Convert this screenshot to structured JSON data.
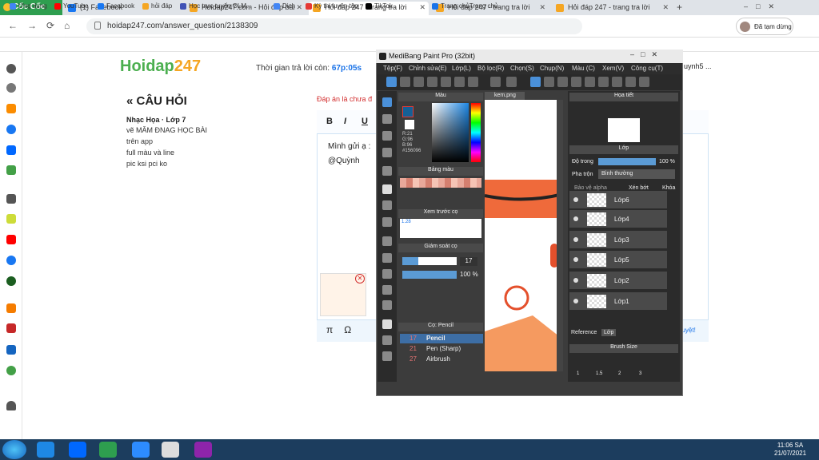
{
  "browser": {
    "brand": "Cốc Cốc",
    "tabs": [
      "(1) Facebook",
      "Hoidap247.com - Hỏi đáp bài",
      "Hỏi đáp 247 - trang tra lời",
      "Hỏi đáp 247 - trang tra lời",
      "Hỏi đáp 247 - trang tra lời"
    ],
    "url": "hoidap247.com/answer_question/2138309",
    "user_label": "Đã tạm dừng"
  },
  "bookmarks": [
    "Ứng dụng",
    "YouTube",
    "Facebook",
    "hỏi đáp",
    "Học trực tuyến OLM...",
    "Dich",
    "Kỳ thi luyện tập",
    "TikTok",
    "Trang chủTrang chủ"
  ],
  "page": {
    "logo_main": "Hoidap",
    "logo_num": "247",
    "timer_label": "Thời gian trả lời còn:",
    "timer_value": "67p:05s",
    "user_snip": "uynh5 ...",
    "question_heading": "« CÂU HỎI",
    "question_meta": "Nhạc Họa · Lớp 7",
    "question_lines": [
      "vẽ MĂM ĐNAG HỌC BÀI",
      "trên app",
      "full màu và line",
      "pic ksi pci ko"
    ],
    "answer_warning": "Đáp án là chưa đ",
    "editor_lines": [
      "Mình gửi ạ :",
      "@Quỳnh"
    ],
    "approve_snip": "duyệt!",
    "tools": [
      "B",
      "I",
      "U"
    ]
  },
  "medibang": {
    "title": "MediBang Paint Pro (32bit)",
    "menu": [
      "Tệp(F)",
      "Chỉnh sửa(E)",
      "Lớp(L)",
      "Bộ lọc(R)",
      "Chọn(S)",
      "Chụp(N)",
      "Màu (C)",
      "Xem(V)",
      "Công cụ(T)"
    ],
    "panels": {
      "color": "Màu",
      "palette": "Bảng màu",
      "brush_preview": "Xem trước cọ",
      "brush_control": "Giám soát cọ",
      "brush": "Cọ: Pencil",
      "navigator": "Họa tiết",
      "layer": "Lớp",
      "brush_size": "Brush Size"
    },
    "color_values": [
      "R:21",
      "G:96",
      "B:96",
      "#156096"
    ],
    "brush_size_value": "17",
    "opacity_value": "100 %",
    "brushes": [
      {
        "size": "17",
        "name": "Pencil"
      },
      {
        "size": "21",
        "name": "Pen (Sharp)"
      },
      {
        "size": "27",
        "name": "Airbrush"
      }
    ],
    "canvas_tab": "kem.png",
    "layer_opacity_label": "Độ trong",
    "layer_opacity": "100 %",
    "blend_label": "Pha trộn",
    "blend_value": "Bình thường",
    "protect_alpha": "Bảo vệ alpha",
    "clip": "Xén bớt",
    "lock": "Khóa",
    "layers": [
      "Lớp6",
      "Lớp4",
      "Lớp3",
      "Lớp5",
      "Lớp2",
      "Lớp1"
    ],
    "ref_tabs": [
      "Reference",
      "Lớp"
    ],
    "sizes": [
      "1",
      "1.5",
      "2",
      "3"
    ],
    "preview_size": "1.28"
  },
  "taskbar": {
    "time": "11:06 SA",
    "date": "21/07/2021"
  }
}
